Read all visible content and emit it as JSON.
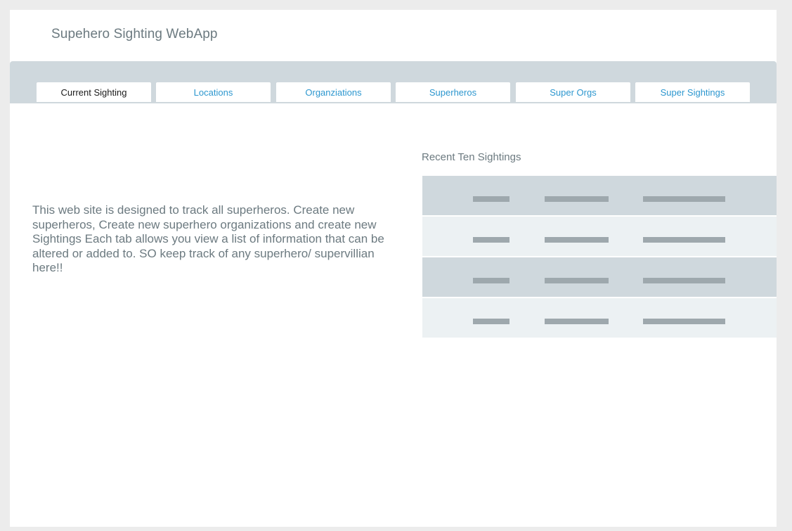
{
  "app": {
    "title": "Supehero Sighting WebApp"
  },
  "tabs": [
    {
      "label": "Current Sighting",
      "active": true
    },
    {
      "label": "Locations",
      "active": false
    },
    {
      "label": "Organziations",
      "active": false
    },
    {
      "label": "Superheros",
      "active": false
    },
    {
      "label": "Super Orgs",
      "active": false
    },
    {
      "label": "Super Sightings",
      "active": false
    }
  ],
  "main": {
    "intro_text": "This web site is designed to track all superheros. Create new superheros, Create new superhero organizations and  create new Sightings Each tab allows you view a list of information that can be altered or added to. SO keep track of any superhero/ supervillian here!!"
  },
  "recent": {
    "title": "Recent Ten Sightings",
    "rows": [
      {
        "shade": "dark"
      },
      {
        "shade": "light"
      },
      {
        "shade": "dark"
      },
      {
        "shade": "light"
      }
    ]
  },
  "colors": {
    "tab_link": "#2d97cf",
    "muted_text": "#6c7a80",
    "tab_bar_bg": "#cfd8dd",
    "row_dark": "#cfd8dd",
    "row_light": "#ecf1f3",
    "placeholder_bar": "#9ea8ad"
  }
}
